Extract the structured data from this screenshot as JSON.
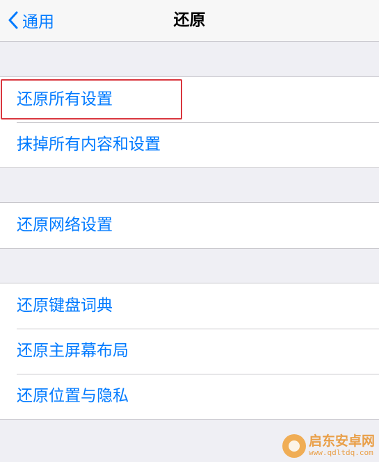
{
  "navbar": {
    "back_label": "通用",
    "title": "还原"
  },
  "groups": [
    {
      "items": [
        "还原所有设置",
        "抹掉所有内容和设置"
      ]
    },
    {
      "items": [
        "还原网络设置"
      ]
    },
    {
      "items": [
        "还原键盘词典",
        "还原主屏幕布局",
        "还原位置与隐私"
      ]
    }
  ],
  "watermark": {
    "name": "启东安卓网",
    "url": "www.qdltdq.com"
  },
  "colors": {
    "accent": "#007aff",
    "background": "#efeff4",
    "highlight": "#d9363e"
  }
}
